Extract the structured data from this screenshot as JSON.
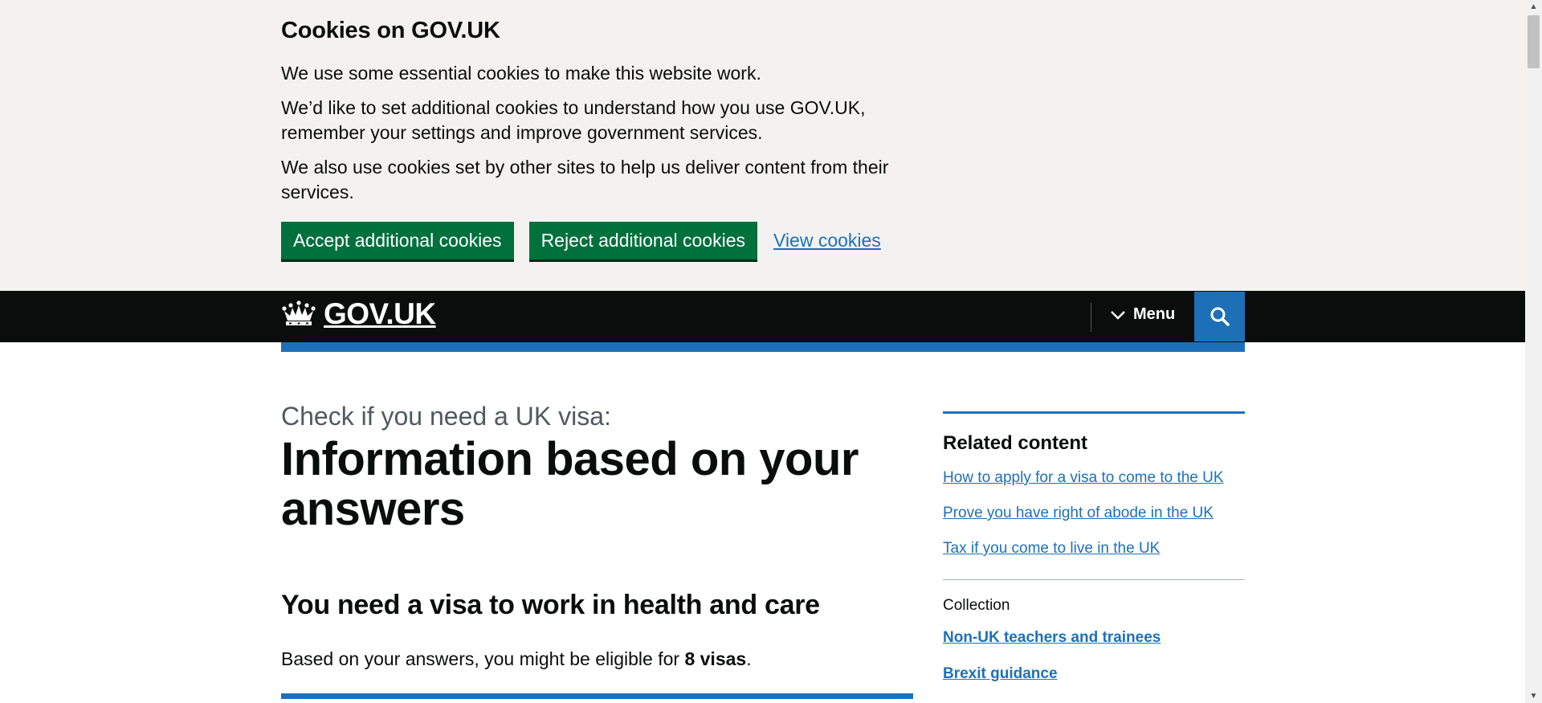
{
  "cookie_banner": {
    "title": "Cookies on GOV.UK",
    "paragraph1": "We use some essential cookies to make this website work.",
    "paragraph2": "We’d like to set additional cookies to understand how you use GOV.UK, remember your settings and improve government services.",
    "paragraph3": "We also use cookies set by other sites to help us deliver content from their services.",
    "accept_label": "Accept additional cookies",
    "reject_label": "Reject additional cookies",
    "view_label": "View cookies"
  },
  "header": {
    "logo_text": "GOV.UK",
    "menu_label": "Menu",
    "search_icon": "search-icon",
    "colors": {
      "background": "#0b0c0c",
      "accent": "#1d70b8"
    }
  },
  "main": {
    "caption": "Check if you need a UK visa:",
    "title": "Information based on your answers",
    "subheading": "You need a visa to work in health and care",
    "body_prefix": "Based on your answers, you might be eligible for ",
    "body_bold": "8 visas",
    "body_suffix": "."
  },
  "sidebar": {
    "related_title": "Related content",
    "related_links": [
      "How to apply for a visa to come to the UK",
      "Prove you have right of abode in the UK",
      "Tax if you come to live in the UK"
    ],
    "collection_label": "Collection",
    "collection_links": [
      "Non-UK teachers and trainees",
      "Brexit guidance"
    ]
  },
  "colors": {
    "button_green": "#00703c",
    "link_blue": "#1d70b8",
    "banner_grey": "#f3f2f1"
  }
}
